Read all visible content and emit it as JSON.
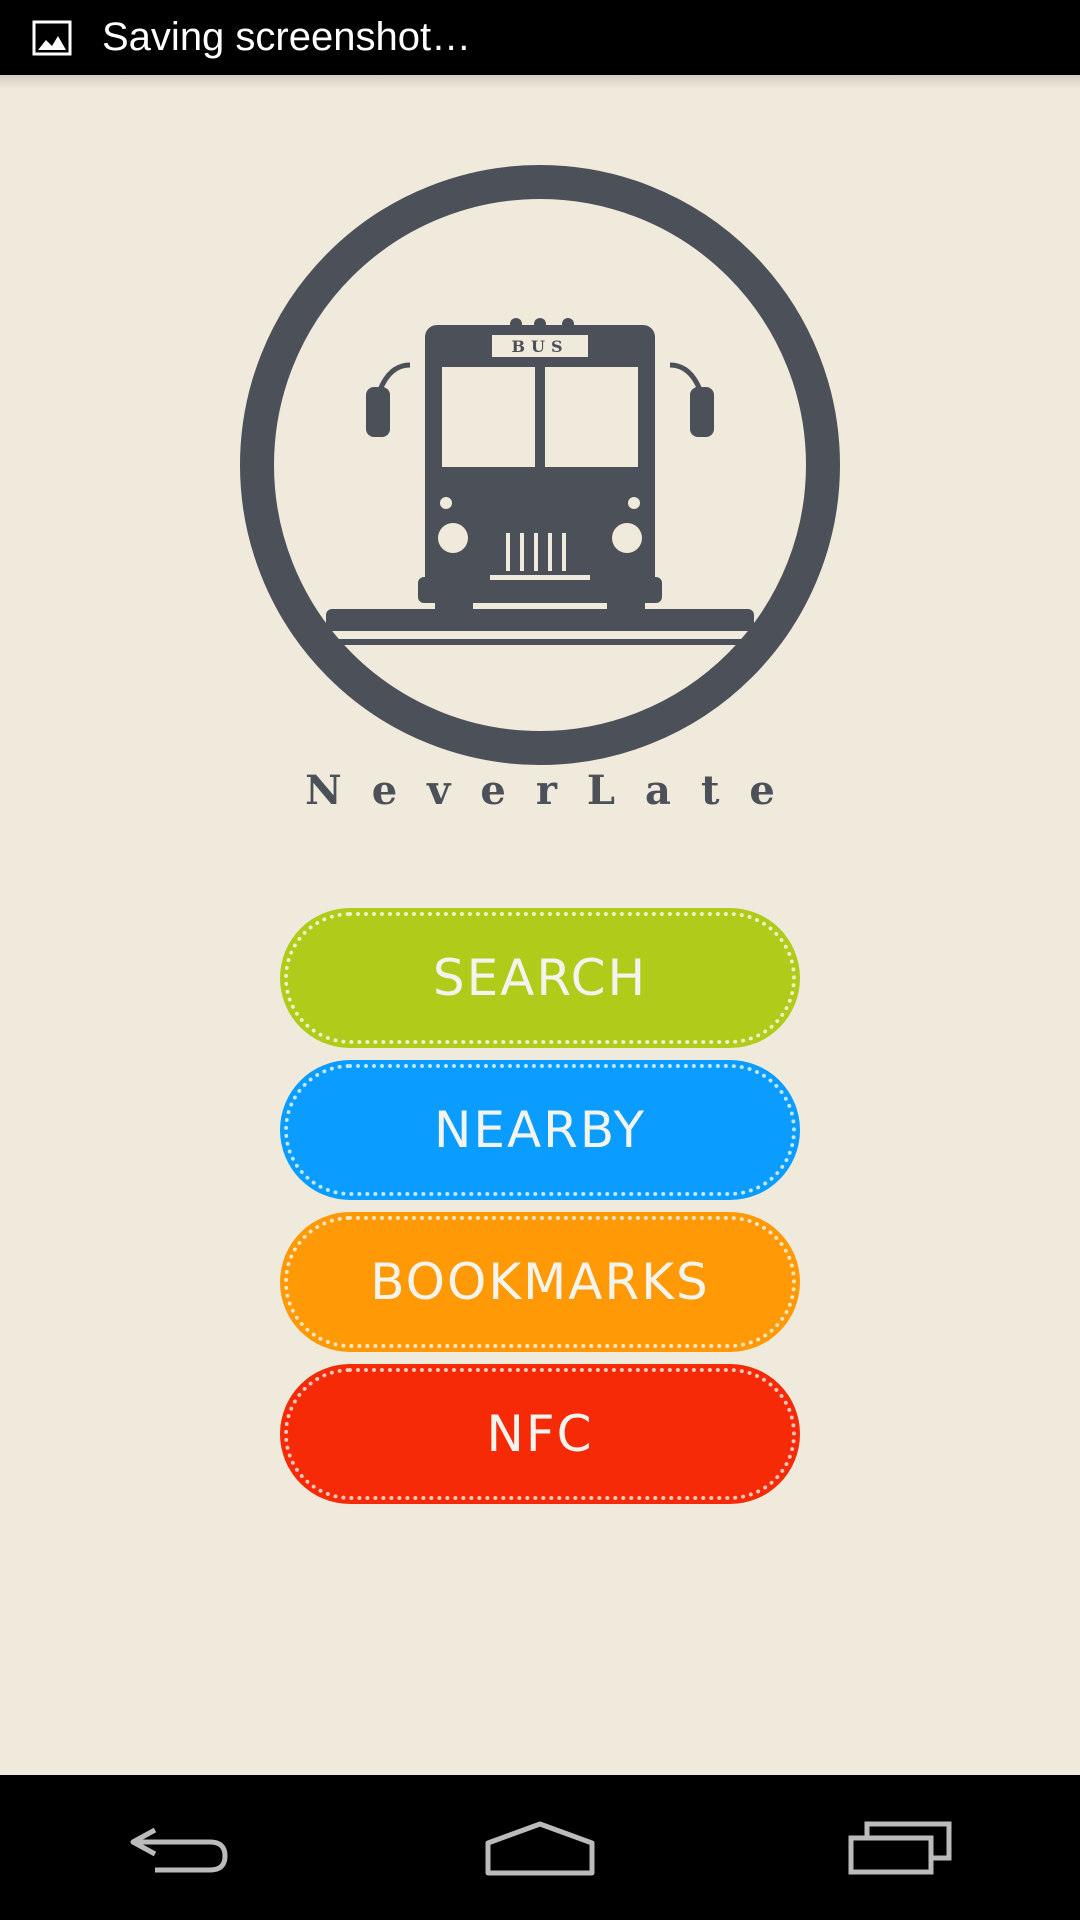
{
  "status_bar": {
    "notification_icon": "image-icon",
    "text": "Saving screenshot…"
  },
  "app": {
    "logo_label": "BUS",
    "name": "NeverLate"
  },
  "menu": {
    "buttons": [
      {
        "label": "SEARCH",
        "color": "#b0cb19"
      },
      {
        "label": "NEARBY",
        "color": "#0a9cff"
      },
      {
        "label": "BOOKMARKS",
        "color": "#ff9a06"
      },
      {
        "label": "NFC",
        "color": "#f62a06"
      }
    ]
  },
  "nav_bar": {
    "back": "back-icon",
    "home": "home-icon",
    "recents": "recents-icon"
  }
}
